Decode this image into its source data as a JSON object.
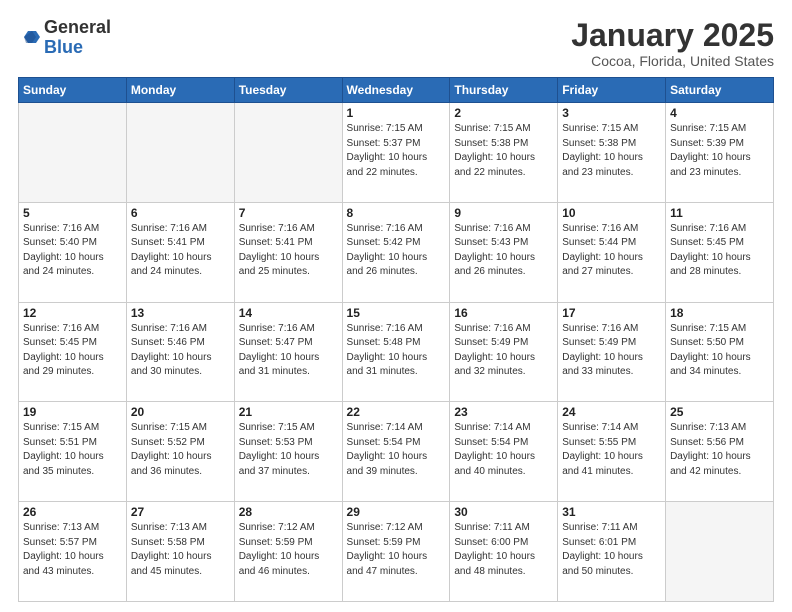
{
  "header": {
    "logo_general": "General",
    "logo_blue": "Blue",
    "month_title": "January 2025",
    "location": "Cocoa, Florida, United States"
  },
  "weekdays": [
    "Sunday",
    "Monday",
    "Tuesday",
    "Wednesday",
    "Thursday",
    "Friday",
    "Saturday"
  ],
  "weeks": [
    [
      {
        "day": "",
        "info": ""
      },
      {
        "day": "",
        "info": ""
      },
      {
        "day": "",
        "info": ""
      },
      {
        "day": "1",
        "info": "Sunrise: 7:15 AM\nSunset: 5:37 PM\nDaylight: 10 hours\nand 22 minutes."
      },
      {
        "day": "2",
        "info": "Sunrise: 7:15 AM\nSunset: 5:38 PM\nDaylight: 10 hours\nand 22 minutes."
      },
      {
        "day": "3",
        "info": "Sunrise: 7:15 AM\nSunset: 5:38 PM\nDaylight: 10 hours\nand 23 minutes."
      },
      {
        "day": "4",
        "info": "Sunrise: 7:15 AM\nSunset: 5:39 PM\nDaylight: 10 hours\nand 23 minutes."
      }
    ],
    [
      {
        "day": "5",
        "info": "Sunrise: 7:16 AM\nSunset: 5:40 PM\nDaylight: 10 hours\nand 24 minutes."
      },
      {
        "day": "6",
        "info": "Sunrise: 7:16 AM\nSunset: 5:41 PM\nDaylight: 10 hours\nand 24 minutes."
      },
      {
        "day": "7",
        "info": "Sunrise: 7:16 AM\nSunset: 5:41 PM\nDaylight: 10 hours\nand 25 minutes."
      },
      {
        "day": "8",
        "info": "Sunrise: 7:16 AM\nSunset: 5:42 PM\nDaylight: 10 hours\nand 26 minutes."
      },
      {
        "day": "9",
        "info": "Sunrise: 7:16 AM\nSunset: 5:43 PM\nDaylight: 10 hours\nand 26 minutes."
      },
      {
        "day": "10",
        "info": "Sunrise: 7:16 AM\nSunset: 5:44 PM\nDaylight: 10 hours\nand 27 minutes."
      },
      {
        "day": "11",
        "info": "Sunrise: 7:16 AM\nSunset: 5:45 PM\nDaylight: 10 hours\nand 28 minutes."
      }
    ],
    [
      {
        "day": "12",
        "info": "Sunrise: 7:16 AM\nSunset: 5:45 PM\nDaylight: 10 hours\nand 29 minutes."
      },
      {
        "day": "13",
        "info": "Sunrise: 7:16 AM\nSunset: 5:46 PM\nDaylight: 10 hours\nand 30 minutes."
      },
      {
        "day": "14",
        "info": "Sunrise: 7:16 AM\nSunset: 5:47 PM\nDaylight: 10 hours\nand 31 minutes."
      },
      {
        "day": "15",
        "info": "Sunrise: 7:16 AM\nSunset: 5:48 PM\nDaylight: 10 hours\nand 31 minutes."
      },
      {
        "day": "16",
        "info": "Sunrise: 7:16 AM\nSunset: 5:49 PM\nDaylight: 10 hours\nand 32 minutes."
      },
      {
        "day": "17",
        "info": "Sunrise: 7:16 AM\nSunset: 5:49 PM\nDaylight: 10 hours\nand 33 minutes."
      },
      {
        "day": "18",
        "info": "Sunrise: 7:15 AM\nSunset: 5:50 PM\nDaylight: 10 hours\nand 34 minutes."
      }
    ],
    [
      {
        "day": "19",
        "info": "Sunrise: 7:15 AM\nSunset: 5:51 PM\nDaylight: 10 hours\nand 35 minutes."
      },
      {
        "day": "20",
        "info": "Sunrise: 7:15 AM\nSunset: 5:52 PM\nDaylight: 10 hours\nand 36 minutes."
      },
      {
        "day": "21",
        "info": "Sunrise: 7:15 AM\nSunset: 5:53 PM\nDaylight: 10 hours\nand 37 minutes."
      },
      {
        "day": "22",
        "info": "Sunrise: 7:14 AM\nSunset: 5:54 PM\nDaylight: 10 hours\nand 39 minutes."
      },
      {
        "day": "23",
        "info": "Sunrise: 7:14 AM\nSunset: 5:54 PM\nDaylight: 10 hours\nand 40 minutes."
      },
      {
        "day": "24",
        "info": "Sunrise: 7:14 AM\nSunset: 5:55 PM\nDaylight: 10 hours\nand 41 minutes."
      },
      {
        "day": "25",
        "info": "Sunrise: 7:13 AM\nSunset: 5:56 PM\nDaylight: 10 hours\nand 42 minutes."
      }
    ],
    [
      {
        "day": "26",
        "info": "Sunrise: 7:13 AM\nSunset: 5:57 PM\nDaylight: 10 hours\nand 43 minutes."
      },
      {
        "day": "27",
        "info": "Sunrise: 7:13 AM\nSunset: 5:58 PM\nDaylight: 10 hours\nand 45 minutes."
      },
      {
        "day": "28",
        "info": "Sunrise: 7:12 AM\nSunset: 5:59 PM\nDaylight: 10 hours\nand 46 minutes."
      },
      {
        "day": "29",
        "info": "Sunrise: 7:12 AM\nSunset: 5:59 PM\nDaylight: 10 hours\nand 47 minutes."
      },
      {
        "day": "30",
        "info": "Sunrise: 7:11 AM\nSunset: 6:00 PM\nDaylight: 10 hours\nand 48 minutes."
      },
      {
        "day": "31",
        "info": "Sunrise: 7:11 AM\nSunset: 6:01 PM\nDaylight: 10 hours\nand 50 minutes."
      },
      {
        "day": "",
        "info": ""
      }
    ]
  ]
}
